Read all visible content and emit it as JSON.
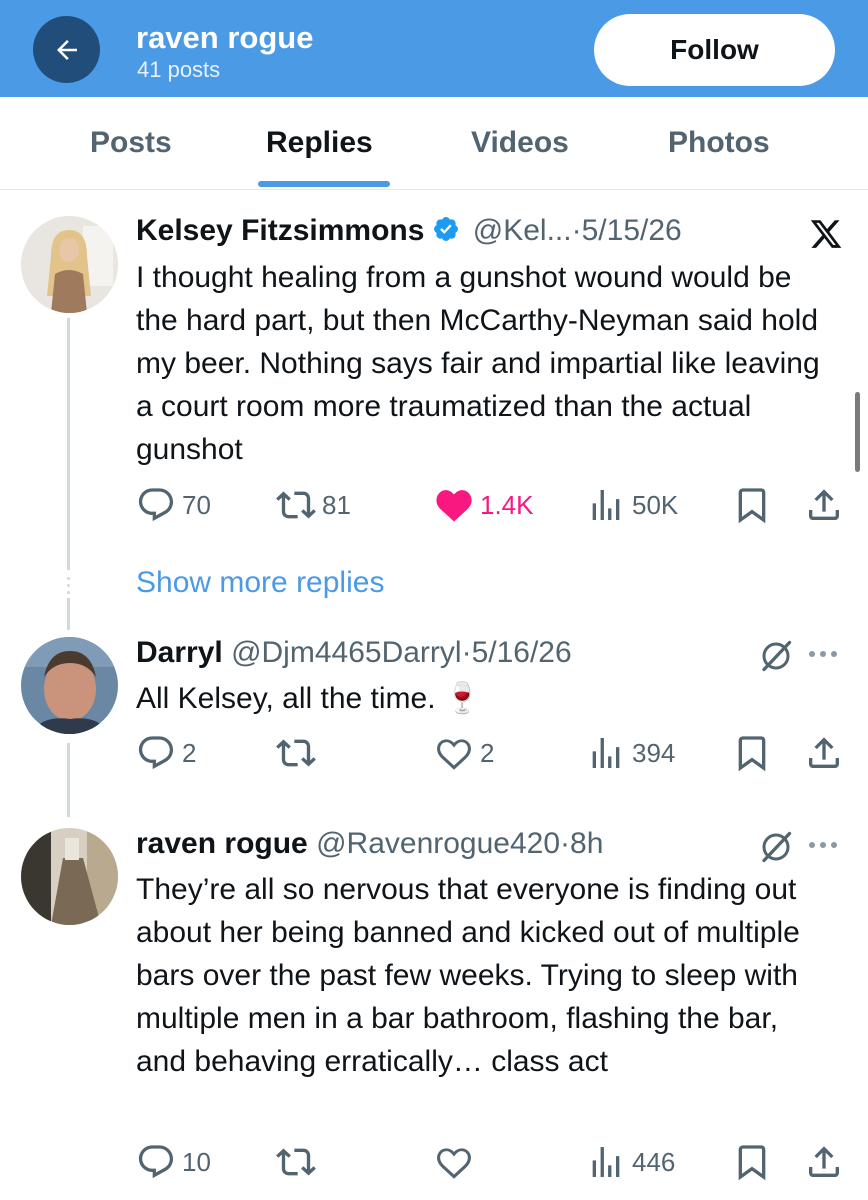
{
  "header": {
    "name": "raven rogue",
    "post_count": "41 posts",
    "follow_label": "Follow",
    "accent_color": "#4a9ae6"
  },
  "tabs": [
    {
      "label": "Posts",
      "active": false
    },
    {
      "label": "Replies",
      "active": true
    },
    {
      "label": "Videos",
      "active": false
    },
    {
      "label": "Photos",
      "active": false
    }
  ],
  "tweets": [
    {
      "author": "Kelsey Fitzsimmons",
      "verified": true,
      "handle": "@Kel...",
      "separator": "·",
      "time": "5/15/26",
      "text": "I thought healing from a gunshot wound would be the hard part, but then McCarthy-Neyman said hold my beer. Nothing says fair and impartial like leaving a court room more traumatized than the actual gunshot",
      "corner_icon": "x-logo-icon",
      "replies": "70",
      "reposts": "81",
      "likes": "1.4K",
      "liked": true,
      "views": "50K"
    },
    {
      "author": "Darryl",
      "verified": false,
      "handle": "@Djm4465Darryl",
      "separator": "·",
      "time": "5/16/26",
      "text": "All Kelsey, all the time. 🍷",
      "corner_icon": "grok-icon",
      "replies": "2",
      "reposts": "",
      "likes": "2",
      "liked": false,
      "views": "394"
    },
    {
      "author": "raven rogue",
      "verified": false,
      "handle": "@Ravenrogue420",
      "separator": "·",
      "time": "8h",
      "text": "They’re all so nervous that everyone is finding out about her being banned and kicked out of multiple bars over the past few weeks. Trying to sleep with multiple men in a bar bathroom, flashing the bar, and behaving erratically… class act",
      "corner_icon": "grok-icon",
      "replies": "10",
      "reposts": "",
      "likes": "",
      "liked": false,
      "views": "446"
    }
  ],
  "show_more_label": "Show more replies",
  "colors": {
    "like_pink": "#f91880",
    "link_blue": "#4a9ae6",
    "muted_gray": "#536471"
  }
}
